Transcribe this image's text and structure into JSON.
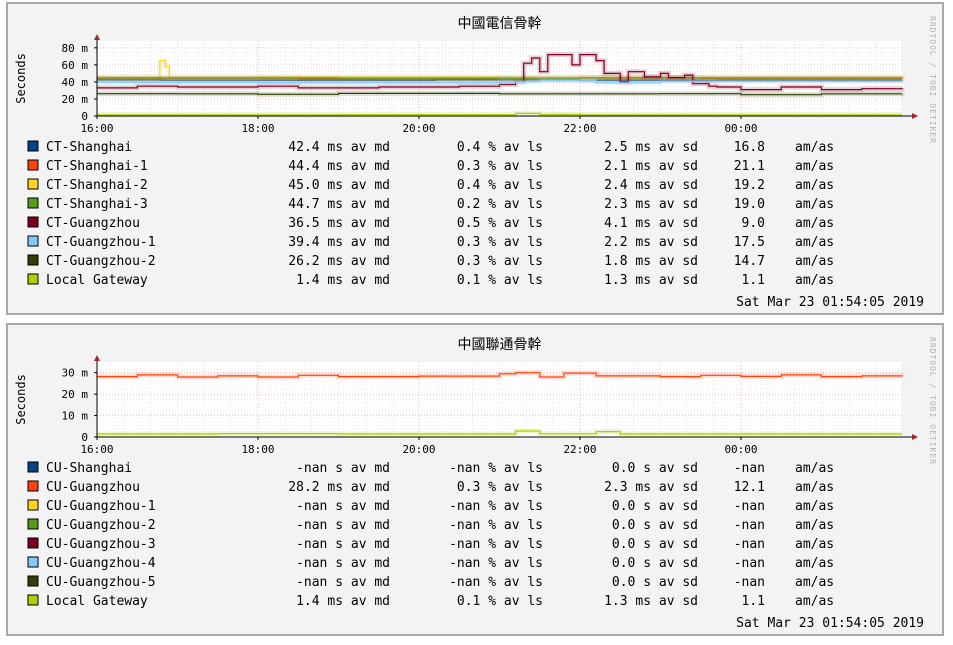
{
  "chart_data": [
    {
      "type": "line",
      "title": "中國電信骨幹",
      "ylabel": "Seconds",
      "watermark": "RRDTOOL / TOBI OETIKER",
      "x_ticks": [
        "16:00",
        "18:00",
        "20:00",
        "22:00",
        "00:00"
      ],
      "y_ticks": [
        "0",
        "20 m",
        "40 m",
        "60 m",
        "80 m"
      ],
      "ylim": [
        0,
        0.088
      ],
      "grid": true,
      "timestamp": "Sat Mar 23 01:54:05 2019",
      "series": [
        {
          "name": "CT-Shanghai",
          "color": "#004586",
          "stats": {
            "median": "42.4 ms av md",
            "loss": "0.4 % av ls",
            "sd": "2.5 ms av sd",
            "ratio": "16.8",
            "unit": "am/as"
          },
          "segments": [
            [
              0,
              0.0424
            ],
            [
              0.08,
              0.0421
            ],
            [
              0.42,
              0.0425
            ],
            [
              0.6,
              0.0421
            ],
            [
              0.77,
              0.0424
            ],
            [
              1.0,
              0.0424
            ]
          ]
        },
        {
          "name": "CT-Shanghai-1",
          "color": "#ff420e",
          "stats": {
            "median": "44.4 ms av md",
            "loss": "0.3 % av ls",
            "sd": "2.1 ms av sd",
            "ratio": "21.1",
            "unit": "am/as"
          },
          "segments": [
            [
              0,
              0.0444
            ],
            [
              0.25,
              0.0438
            ],
            [
              0.5,
              0.0446
            ],
            [
              0.75,
              0.0441
            ],
            [
              1.0,
              0.0444
            ]
          ]
        },
        {
          "name": "CT-Shanghai-2",
          "color": "#ffd320",
          "stats": {
            "median": "45.0 ms av md",
            "loss": "0.4 % av ls",
            "sd": "2.4 ms av sd",
            "ratio": "19.2",
            "unit": "am/as"
          },
          "segments": [
            [
              0,
              0.045
            ],
            [
              0.075,
              0.045
            ],
            [
              0.078,
              0.065
            ],
            [
              0.085,
              0.058
            ],
            [
              0.09,
              0.045
            ],
            [
              0.2,
              0.0455
            ],
            [
              0.5,
              0.045
            ],
            [
              0.77,
              0.0448
            ],
            [
              1.0,
              0.045
            ]
          ]
        },
        {
          "name": "CT-Shanghai-3",
          "color": "#579d1c",
          "stats": {
            "median": "44.7 ms av md",
            "loss": "0.2 % av ls",
            "sd": "2.3 ms av sd",
            "ratio": "19.0",
            "unit": "am/as"
          },
          "segments": [
            [
              0,
              0.0447
            ],
            [
              0.3,
              0.0443
            ],
            [
              0.6,
              0.0448
            ],
            [
              1.0,
              0.0447
            ]
          ]
        },
        {
          "name": "CT-Guangzhou",
          "color": "#7e0021",
          "stats": {
            "median": "36.5 ms av md",
            "loss": "0.5 % av ls",
            "sd": "4.1 ms av sd",
            "ratio": "9.0",
            "unit": "am/as"
          },
          "segments": [
            [
              0,
              0.033
            ],
            [
              0.05,
              0.035
            ],
            [
              0.1,
              0.034
            ],
            [
              0.2,
              0.035
            ],
            [
              0.25,
              0.033
            ],
            [
              0.35,
              0.034
            ],
            [
              0.45,
              0.035
            ],
            [
              0.5,
              0.037
            ],
            [
              0.52,
              0.04
            ],
            [
              0.53,
              0.062
            ],
            [
              0.54,
              0.068
            ],
            [
              0.55,
              0.052
            ],
            [
              0.56,
              0.072
            ],
            [
              0.59,
              0.06
            ],
            [
              0.6,
              0.072
            ],
            [
              0.62,
              0.065
            ],
            [
              0.63,
              0.05
            ],
            [
              0.65,
              0.04
            ],
            [
              0.66,
              0.052
            ],
            [
              0.68,
              0.046
            ],
            [
              0.7,
              0.05
            ],
            [
              0.71,
              0.045
            ],
            [
              0.73,
              0.048
            ],
            [
              0.74,
              0.038
            ],
            [
              0.76,
              0.035
            ],
            [
              0.77,
              0.034
            ],
            [
              0.8,
              0.031
            ],
            [
              0.85,
              0.034
            ],
            [
              0.9,
              0.031
            ],
            [
              0.95,
              0.032
            ],
            [
              1.0,
              0.033
            ]
          ]
        },
        {
          "name": "CT-Guangzhou-1",
          "color": "#83caff",
          "stats": {
            "median": "39.4 ms av md",
            "loss": "0.3 % av ls",
            "sd": "2.2 ms av sd",
            "ratio": "17.5",
            "unit": "am/as"
          },
          "segments": [
            [
              0,
              0.0394
            ],
            [
              0.2,
              0.039
            ],
            [
              0.5,
              0.04
            ],
            [
              0.55,
              0.042
            ],
            [
              0.62,
              0.039
            ],
            [
              0.7,
              0.041
            ],
            [
              1.0,
              0.0395
            ]
          ]
        },
        {
          "name": "CT-Guangzhou-2",
          "color": "#314004",
          "stats": {
            "median": "26.2 ms av md",
            "loss": "0.3 % av ls",
            "sd": "1.8 ms av sd",
            "ratio": "14.7",
            "unit": "am/as"
          },
          "segments": [
            [
              0,
              0.0262
            ],
            [
              0.1,
              0.026
            ],
            [
              0.2,
              0.0255
            ],
            [
              0.3,
              0.0265
            ],
            [
              0.5,
              0.026
            ],
            [
              0.7,
              0.0262
            ],
            [
              0.8,
              0.025
            ],
            [
              0.9,
              0.026
            ],
            [
              1.0,
              0.0262
            ]
          ]
        },
        {
          "name": "Local Gateway",
          "color": "#aecf00",
          "stats": {
            "median": "1.4 ms av md",
            "loss": "0.1 % av ls",
            "sd": "1.3 ms av sd",
            "ratio": "1.1",
            "unit": "am/as"
          },
          "segments": [
            [
              0,
              0.0014
            ],
            [
              0.3,
              0.0015
            ],
            [
              0.52,
              0.003
            ],
            [
              0.55,
              0.0018
            ],
            [
              0.6,
              0.0014
            ],
            [
              1.0,
              0.0014
            ]
          ]
        }
      ]
    },
    {
      "type": "line",
      "title": "中國聯通骨幹",
      "ylabel": "Seconds",
      "watermark": "RRDTOOL / TOBI OETIKER",
      "x_ticks": [
        "16:00",
        "18:00",
        "20:00",
        "22:00",
        "00:00"
      ],
      "y_ticks": [
        "0",
        "10 m",
        "20 m",
        "30 m"
      ],
      "ylim": [
        0,
        0.035
      ],
      "grid": true,
      "timestamp": "Sat Mar 23 01:54:05 2019",
      "series": [
        {
          "name": "CU-Shanghai",
          "color": "#004586",
          "stats": {
            "median": "-nan  s av md",
            "loss": "-nan % av ls",
            "sd": "0.0  s av sd",
            "ratio": "-nan",
            "unit": "am/as"
          },
          "segments": []
        },
        {
          "name": "CU-Guangzhou",
          "color": "#ff420e",
          "stats": {
            "median": "28.2 ms av md",
            "loss": "0.3 % av ls",
            "sd": "2.3 ms av sd",
            "ratio": "12.1",
            "unit": "am/as"
          },
          "segments": [
            [
              0,
              0.0282
            ],
            [
              0.05,
              0.029
            ],
            [
              0.1,
              0.028
            ],
            [
              0.15,
              0.0285
            ],
            [
              0.2,
              0.028
            ],
            [
              0.25,
              0.0288
            ],
            [
              0.3,
              0.0282
            ],
            [
              0.4,
              0.0284
            ],
            [
              0.5,
              0.0295
            ],
            [
              0.52,
              0.03
            ],
            [
              0.55,
              0.028
            ],
            [
              0.58,
              0.0298
            ],
            [
              0.62,
              0.0285
            ],
            [
              0.7,
              0.0282
            ],
            [
              0.75,
              0.0288
            ],
            [
              0.8,
              0.0283
            ],
            [
              0.85,
              0.029
            ],
            [
              0.9,
              0.0282
            ],
            [
              0.95,
              0.0285
            ],
            [
              1.0,
              0.0282
            ]
          ]
        },
        {
          "name": "CU-Guangzhou-1",
          "color": "#ffd320",
          "stats": {
            "median": "-nan  s av md",
            "loss": "-nan % av ls",
            "sd": "0.0  s av sd",
            "ratio": "-nan",
            "unit": "am/as"
          },
          "segments": []
        },
        {
          "name": "CU-Guangzhou-2",
          "color": "#579d1c",
          "stats": {
            "median": "-nan  s av md",
            "loss": "-nan % av ls",
            "sd": "0.0  s av sd",
            "ratio": "-nan",
            "unit": "am/as"
          },
          "segments": []
        },
        {
          "name": "CU-Guangzhou-3",
          "color": "#7e0021",
          "stats": {
            "median": "-nan  s av md",
            "loss": "-nan % av ls",
            "sd": "0.0  s av sd",
            "ratio": "-nan",
            "unit": "am/as"
          },
          "segments": []
        },
        {
          "name": "CU-Guangzhou-4",
          "color": "#83caff",
          "stats": {
            "median": "-nan  s av md",
            "loss": "-nan % av ls",
            "sd": "0.0  s av sd",
            "ratio": "-nan",
            "unit": "am/as"
          },
          "segments": []
        },
        {
          "name": "CU-Guangzhou-5",
          "color": "#314004",
          "stats": {
            "median": "-nan  s av md",
            "loss": "-nan % av ls",
            "sd": "0.0  s av sd",
            "ratio": "-nan",
            "unit": "am/as"
          },
          "segments": []
        },
        {
          "name": "Local Gateway",
          "color": "#aecf00",
          "stats": {
            "median": "1.4 ms av md",
            "loss": "0.1 % av ls",
            "sd": "1.3 ms av sd",
            "ratio": "1.1",
            "unit": "am/as"
          },
          "segments": [
            [
              0,
              0.0014
            ],
            [
              0.15,
              0.0016
            ],
            [
              0.3,
              0.0014
            ],
            [
              0.52,
              0.0028
            ],
            [
              0.55,
              0.0015
            ],
            [
              0.62,
              0.0025
            ],
            [
              0.65,
              0.0014
            ],
            [
              1.0,
              0.0014
            ]
          ]
        }
      ]
    }
  ]
}
